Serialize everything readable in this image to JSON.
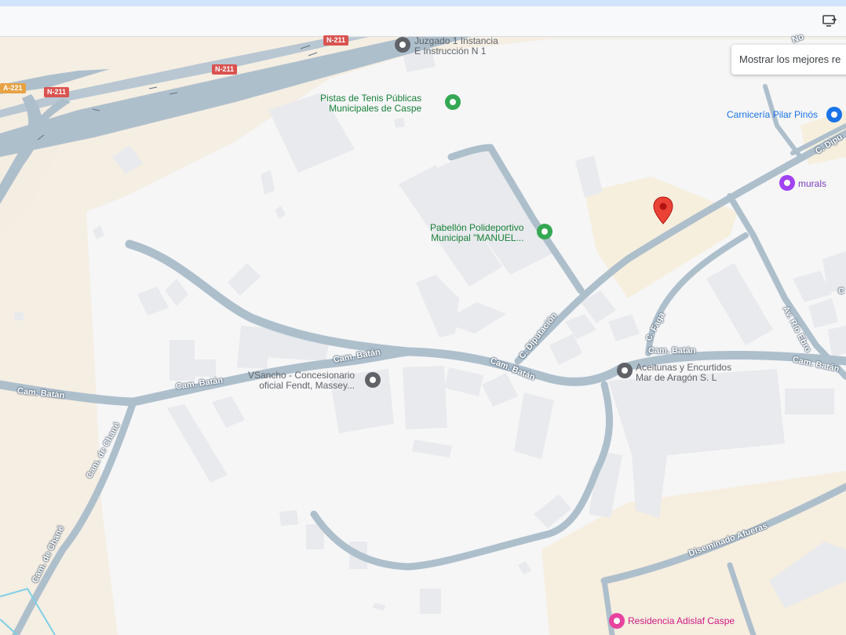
{
  "toolbar": {
    "icon": "screen-share-icon"
  },
  "suggest_button": {
    "label": "Mostrar los mejores re"
  },
  "highways": [
    "N-211",
    "N-211",
    "A-221",
    "N-211"
  ],
  "pois": {
    "juzgado": "Juzgado 1 Instancia\nE Instrucción N 1",
    "tenis": "Pistas de Tenis Públicas\nMunicipales de Caspe",
    "carniceria": "Carnicería Pilar Pinós",
    "murals": "murals",
    "pabellon": "Pabellón Polideportivo\nMunicipal \"MANUEL...",
    "aceitunas": "Aceitunas y Encurtidos\nMar de Aragón S. L",
    "vsancho": "VSancho - Concesionario\noficial Fendt, Massey...",
    "residencia": "Residencia Adislaf Caspe"
  },
  "streets": {
    "batan_1": "Cam. Batán",
    "batan_2": "Cam. Batán",
    "batan_3": "Cam. Batán",
    "batan_4": "Cam. Batán",
    "batan_5": "Cam. Batán",
    "batan_6": "Cam. Batán",
    "diputacion": "C. Diputación",
    "diputacion_2": "C. Dipu",
    "faga": "C. Faga",
    "rio_ebro": "Av. Río Ebro",
    "chane_1": "Cam. de Chané",
    "chane_2": "Cam. de Chané",
    "diseminado": "Diseminado Afueras",
    "c_partial": "C",
    "no_partial": "No"
  },
  "colors": {
    "road": "#aebfcc",
    "land": "#f5eee3",
    "urban": "#f6f6f7",
    "building": "#e8eaed",
    "marker": "#ea4335"
  }
}
